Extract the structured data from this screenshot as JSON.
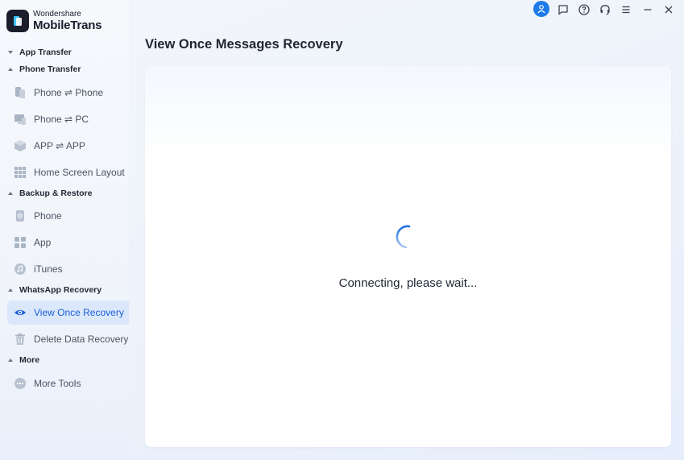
{
  "brand": {
    "small": "Wondershare",
    "name": "MobileTrans"
  },
  "sidebar": {
    "sections": [
      {
        "label": "App Transfer",
        "items": []
      },
      {
        "label": "Phone Transfer",
        "items": [
          {
            "label": "Phone ⇌ Phone",
            "icon": "phone-transfer-icon"
          },
          {
            "label": "Phone ⇌ PC",
            "icon": "phone-pc-icon"
          },
          {
            "label": "APP ⇌ APP",
            "icon": "app-box-icon"
          },
          {
            "label": "Home Screen Layout",
            "icon": "grid-icon"
          }
        ]
      },
      {
        "label": "Backup & Restore",
        "items": [
          {
            "label": "Phone",
            "icon": "phone-backup-icon"
          },
          {
            "label": "App",
            "icon": "apps-icon"
          },
          {
            "label": "iTunes",
            "icon": "itunes-icon"
          }
        ]
      },
      {
        "label": "WhatsApp Recovery",
        "items": [
          {
            "label": "View Once Recovery",
            "icon": "eye-icon",
            "active": true
          },
          {
            "label": "Delete Data Recovery",
            "icon": "trash-icon"
          }
        ]
      },
      {
        "label": "More",
        "items": [
          {
            "label": "More Tools",
            "icon": "more-icon"
          }
        ]
      }
    ]
  },
  "main": {
    "title": "View Once Messages Recovery",
    "status": "Connecting, please wait..."
  },
  "colors": {
    "accent": "#1a5fd6",
    "active_bg": "#dbe8fb",
    "avatar": "#1e7bea"
  }
}
